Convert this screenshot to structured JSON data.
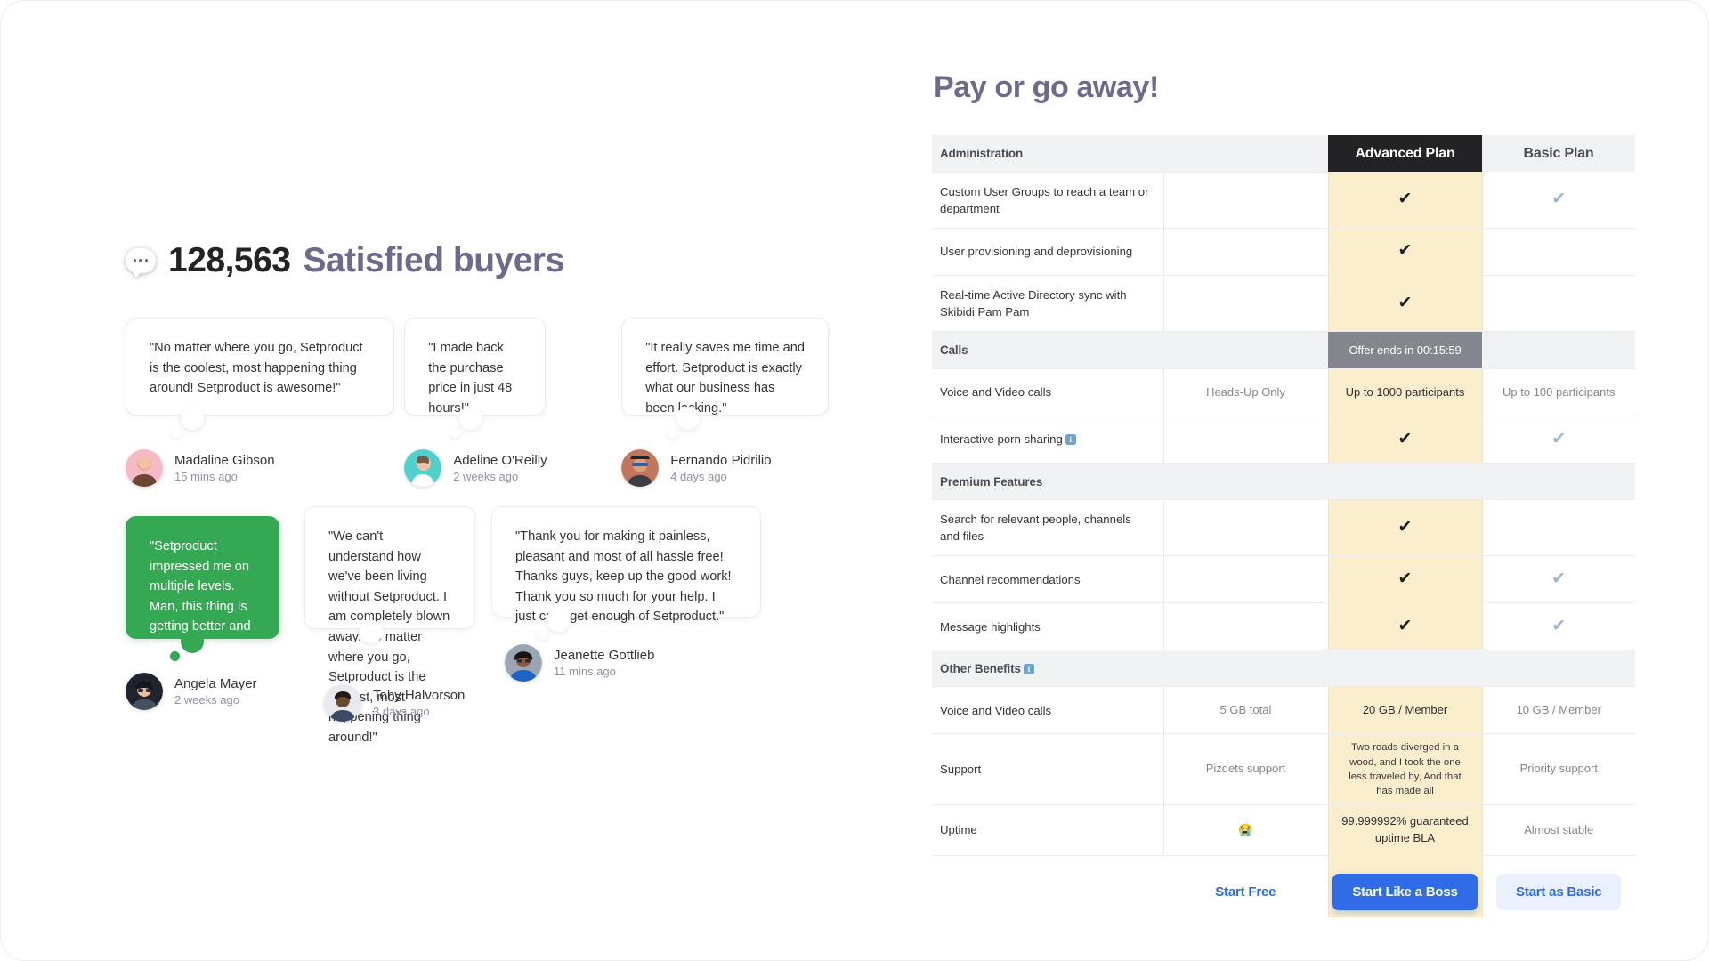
{
  "reviews": {
    "count": "128,563",
    "label": "Satisfied buyers",
    "icon": "speech-bubble-icon",
    "items": [
      {
        "quote": "\"No matter where you go, Setproduct is the coolest, most happening thing around! Setproduct is awesome!\"",
        "name": "Madaline Gibson",
        "time": "15 mins ago",
        "highlight": false
      },
      {
        "quote": "\"I made back the purchase price in just 48 hours!\"",
        "name": "Adeline O'Reilly",
        "time": "2 weeks ago",
        "highlight": false
      },
      {
        "quote": "\"It really saves me time and effort. Setproduct is exactly what our business has been lacking.\"",
        "name": "Fernando Pidrilio",
        "time": "4 days ago",
        "highlight": false
      },
      {
        "quote": "\"Setproduct impressed me on multiple levels. Man, this thing is getting better and better as I learn more about it.\"",
        "name": "Angela Mayer",
        "time": "2 weeks ago",
        "highlight": true
      },
      {
        "quote": "\"We can't understand how we've been living without Setproduct. I am completely blown away. No matter where you go, Setproduct is the coolest, most happening thing around!\"",
        "name": "Toby Halvorson",
        "time": "3 days ago",
        "highlight": false
      },
      {
        "quote": "\"Thank you for making it painless, pleasant and most of all hassle free! Thanks guys, keep up the good work! Thank you so much for your help. I just can't get enough of Setproduct.\"",
        "name": "Jeanette Gottlieb",
        "time": "11 mins ago",
        "highlight": false
      }
    ]
  },
  "pricing": {
    "title": "Pay or go away!",
    "plans": {
      "advanced": "Advanced Plan",
      "basic": "Basic Plan"
    },
    "offer_badge": "Offer ends in 00:15:59",
    "sections": {
      "administration": "Administration",
      "calls": "Calls",
      "premium": "Premium Features",
      "other": "Other Benefits"
    },
    "rows": {
      "custom_user_groups": "Custom User Groups to reach a team or department",
      "user_provisioning": "User provisioning and deprovisioning",
      "ad_sync": "Real-time Active Directory sync with Skibidi Pam Pam",
      "voice_video": "Voice and Video calls",
      "voice_video_free": "Heads-Up Only",
      "voice_video_adv": "Up to 1000 participants",
      "voice_video_basic": "Up to 100 participants",
      "porn_sharing": "Interactive porn sharing",
      "search_relevant": "Search for relevant people, channels and files",
      "channel_recs": "Channel recommendations",
      "message_highlights": "Message highlights",
      "storage": "Voice and Video calls",
      "storage_free": "5 GB total",
      "storage_adv": "20 GB / Member",
      "storage_basic": "10 GB / Member",
      "support": "Support",
      "support_free": "Pizdets support",
      "support_adv": "Two roads diverged in a wood, and I took the one less traveled by, And that has made all",
      "support_basic": "Priority support",
      "uptime": "Uptime",
      "uptime_free": "😭",
      "uptime_adv": "99.999992% guaranteed uptime BLA",
      "uptime_basic": "Almost stable"
    },
    "cta": {
      "free": "Start Free",
      "advanced": "Start Like a Boss",
      "basic": "Start as Basic"
    },
    "check_mark": "✔",
    "colors": {
      "accent_purple": "#6f6a8b",
      "advanced_highlight": "#fbeecd",
      "primary_blue": "#2f6ce5",
      "header_dark": "#232326"
    }
  }
}
